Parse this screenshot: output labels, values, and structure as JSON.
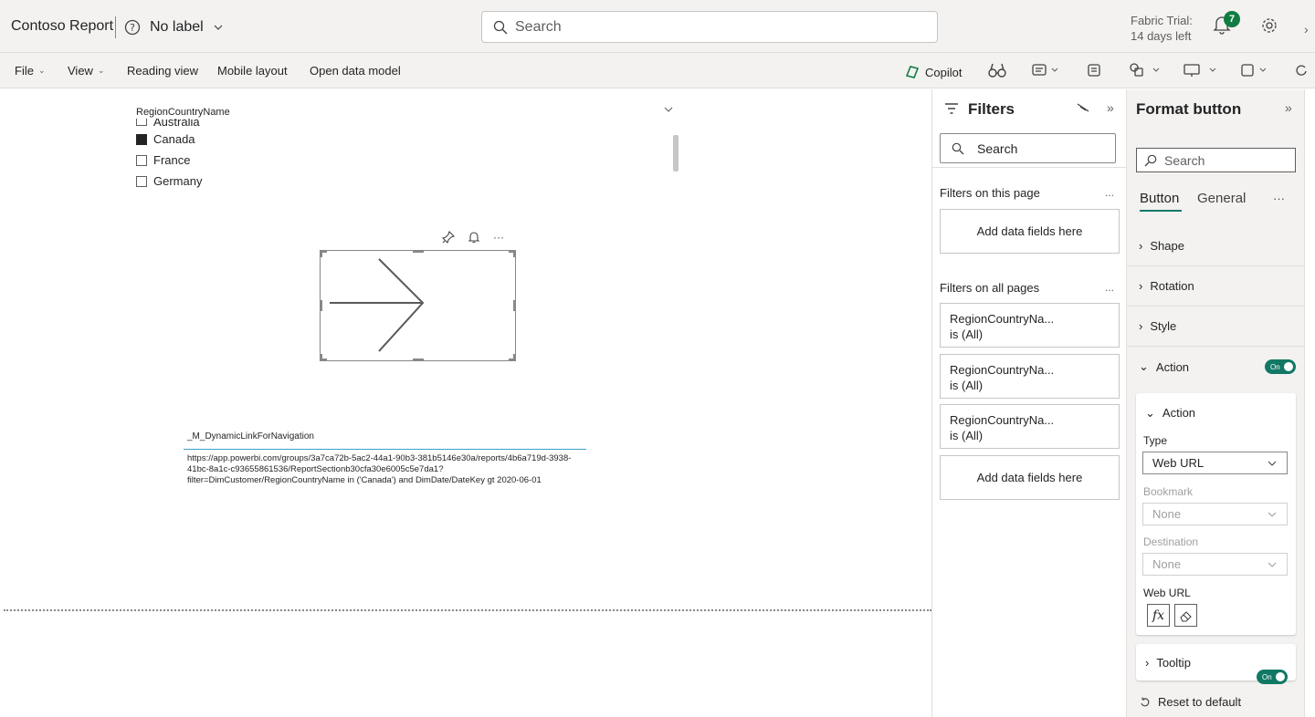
{
  "header": {
    "title": "Contoso Report",
    "label": "No label",
    "search_placeholder": "Search",
    "trial_line1": "Fabric Trial:",
    "trial_line2": "14 days left",
    "notification_count": "7"
  },
  "ribbon": {
    "file": "File",
    "view": "View",
    "reading_view": "Reading view",
    "mobile_layout": "Mobile layout",
    "open_data_model": "Open data model",
    "copilot": "Copilot"
  },
  "canvas": {
    "slicer": {
      "title": "RegionCountryName",
      "items": [
        {
          "label": "Australia",
          "checked": false
        },
        {
          "label": "Canada",
          "checked": true
        },
        {
          "label": "France",
          "checked": false
        },
        {
          "label": "Germany",
          "checked": false
        }
      ]
    },
    "link_visual": {
      "header": "_M_DynamicLinkForNavigation",
      "value": "https://app.powerbi.com/groups/3a7ca72b-5ac2-44a1-90b3-381b5146e30a/reports/4b6a719d-3938-41bc-8a1c-c93655861536/ReportSectionb30cfa30e6005c5e7da1?filter=DimCustomer/RegionCountryName in ('Canada') and DimDate/DateKey gt 2020-06-01"
    }
  },
  "filters": {
    "title": "Filters",
    "search_placeholder": "Search",
    "on_this_page": "Filters on this page",
    "add_fields": "Add data fields here",
    "on_all_pages": "Filters on all pages",
    "more": "...",
    "cards": [
      {
        "name": "RegionCountryNa...",
        "state": "is (All)"
      },
      {
        "name": "RegionCountryNa...",
        "state": "is (All)"
      },
      {
        "name": "RegionCountryNa...",
        "state": "is (All)"
      }
    ]
  },
  "format": {
    "title": "Format button",
    "search_placeholder": "Search",
    "tab_button": "Button",
    "tab_general": "General",
    "more": "···",
    "sections": {
      "shape": "Shape",
      "rotation": "Rotation",
      "style": "Style",
      "action": "Action"
    },
    "toggle_on": "On",
    "action_card": {
      "title": "Action",
      "type_label": "Type",
      "type_value": "Web URL",
      "bookmark_label": "Bookmark",
      "bookmark_value": "None",
      "destination_label": "Destination",
      "destination_value": "None",
      "weburl_label": "Web URL",
      "fx": "fx"
    },
    "tooltip": "Tooltip",
    "reset": "Reset to default"
  }
}
